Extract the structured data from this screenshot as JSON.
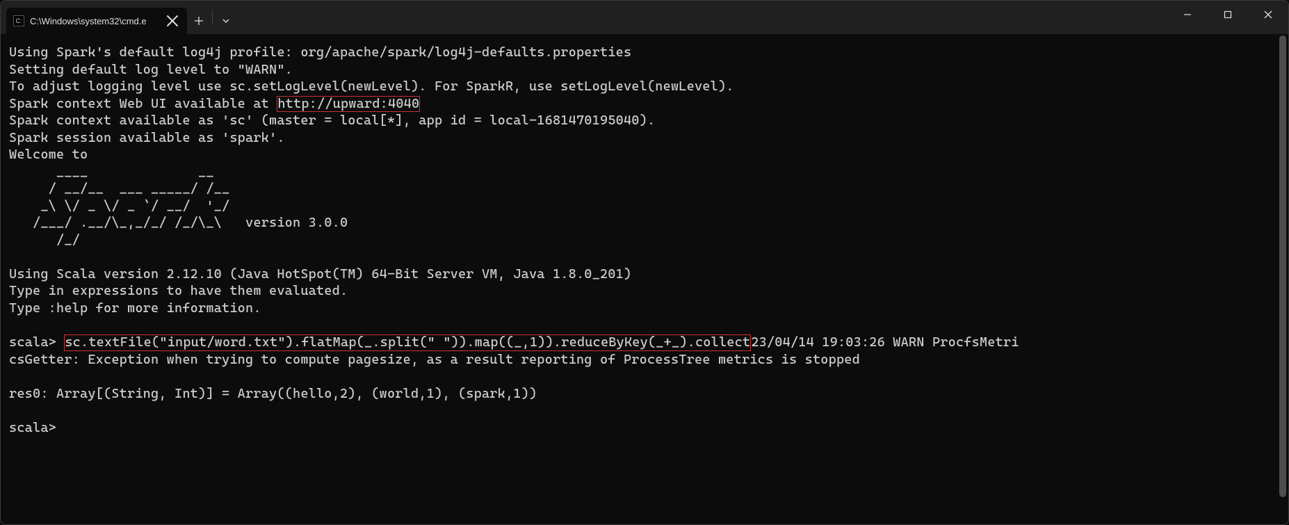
{
  "tab": {
    "title": "C:\\Windows\\system32\\cmd.e",
    "icon_label": "cmd-icon"
  },
  "terminal": {
    "line1": "Using Spark's default log4j profile: org/apache/spark/log4j-defaults.properties",
    "line2": "Setting default log level to \"WARN\".",
    "line3": "To adjust logging level use sc.setLogLevel(newLevel). For SparkR, use setLogLevel(newLevel).",
    "line4a": "Spark context Web UI available at ",
    "line4_hl": "http://upward:4040",
    "line5": "Spark context available as 'sc' (master = local[*], app id = local-1681470195040).",
    "line6": "Spark session available as 'spark'.",
    "line7": "Welcome to",
    "ascii1": "      ____              __",
    "ascii2": "     / __/__  ___ _____/ /__",
    "ascii3": "    _\\ \\/ _ \\/ _ `/ __/  '_/",
    "ascii4": "   /___/ .__/\\_,_/_/ /_/\\_\\   version 3.0.0",
    "ascii5": "      /_/",
    "line8": "Using Scala version 2.12.10 (Java HotSpot(TM) 64-Bit Server VM, Java 1.8.0_201)",
    "line9": "Type in expressions to have them evaluated.",
    "line10": "Type :help for more information.",
    "prompt1a": "scala> ",
    "prompt1_hl": "sc.textFile(\"input/word.txt\").flatMap(_.split(\" \")).map((_,1)).reduceByKey(_+_).collect",
    "prompt1b": "23/04/14 19:03:26 WARN ProcfsMetri",
    "line11": "csGetter: Exception when trying to compute pagesize, as a result reporting of ProcessTree metrics is stopped",
    "line12": "res0: Array[(String, Int)] = Array((hello,2), (world,1), (spark,1))",
    "prompt2": "scala>"
  }
}
